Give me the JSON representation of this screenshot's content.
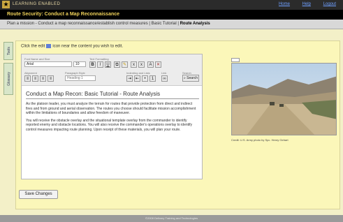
{
  "header": {
    "brand": "LEARNING ENABLED",
    "links": [
      "Home",
      "Help",
      "Logout"
    ]
  },
  "title": "Route Security: Conduct a Map Reconnaissance",
  "breadcrumb": {
    "path": "Plan a mission - Conduct a map reconnaissance/establish control measures | Basic Tutorial | ",
    "current": "Route Analysis"
  },
  "side_tabs": {
    "tools": "Tools",
    "glossary": "Glossary"
  },
  "instruction": {
    "before": "Click the edit",
    "after": "icon near the content you wish to edit."
  },
  "toolbar": {
    "font_label": "Font Name and Size",
    "font_value": "Arial",
    "size_value": "10",
    "formatting_label": "Text Formatting",
    "alignment_label": "Alignment",
    "paragraph_label": "Paragraph Style",
    "paragraph_value": "Heading 1",
    "indenting_label": "Indenting and Lists",
    "link_label": "Link",
    "search_label": "Search",
    "search_button": "Search"
  },
  "content": {
    "heading": "Conduct a Map Recon: Basic Tutorial - Route Analysis",
    "para1": "As the platoon leader, you must analyze the terrain for routes that provide protection from direct and indirect fires and from ground and aerial observation. The routes you choose should facilitate mission accomplishment within the limitations of boundaries and allow freedom of maneuver.",
    "para2": "You will receive the obstacle overlay and the situational template overlay from the commander to identify reported enemy and obstacle locations. You will also receive the commander's operations overlay to identify control measures impacting route planning. Upon receipt of these materials, you will plan your route."
  },
  "photo": {
    "credit": "Credit: U.S. Army photo by Spc. Henry Gehart"
  },
  "save_button": "Save Changes",
  "footer": "©2008 Delivery Training and Technologies"
}
